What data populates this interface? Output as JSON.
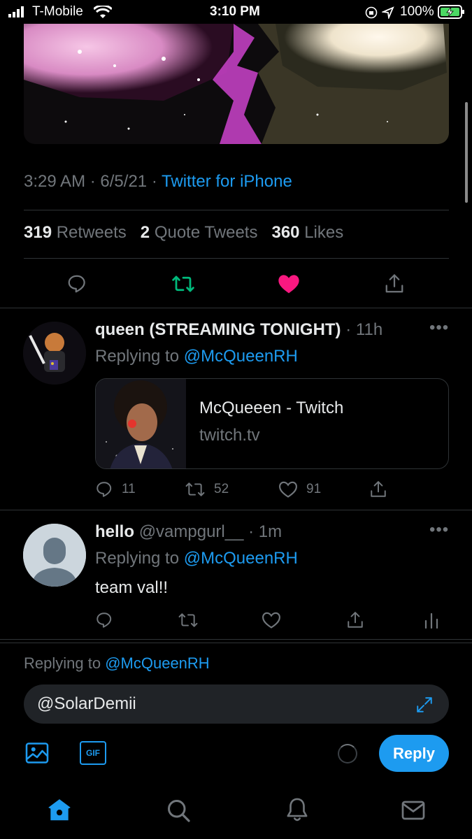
{
  "status_bar": {
    "carrier": "T-Mobile",
    "time": "3:10 PM",
    "battery": "100%"
  },
  "tweet": {
    "time": "3:29 AM",
    "date": "6/5/21",
    "separator": "·",
    "source": "Twitter for iPhone",
    "retweets_count": "319",
    "retweets_label": "Retweets",
    "quotes_count": "2",
    "quotes_label": "Quote Tweets",
    "likes_count": "360",
    "likes_label": "Likes"
  },
  "replies": [
    {
      "name": "queen (STREAMING TONIGHT)",
      "handle": "",
      "time": "11h",
      "replying_label": "Replying to",
      "replying_to": "@McQueenRH",
      "card": {
        "title": "McQueeen - Twitch",
        "domain": "twitch.tv"
      },
      "reply_count": "11",
      "retweet_count": "52",
      "like_count": "91"
    },
    {
      "name": "hello",
      "handle": "@vampgurl__",
      "time": "1m",
      "replying_label": "Replying to",
      "replying_to": "@McQueenRH",
      "text": "team val!!"
    }
  ],
  "composer": {
    "replying_label": "Replying to",
    "replying_to": "@McQueenRH",
    "input_value": "@SolarDemii",
    "gif_label": "GIF",
    "reply_button": "Reply"
  },
  "colors": {
    "accent": "#1d9bf0",
    "retweet_green": "#00ba7c",
    "like_pink": "#f91880"
  }
}
